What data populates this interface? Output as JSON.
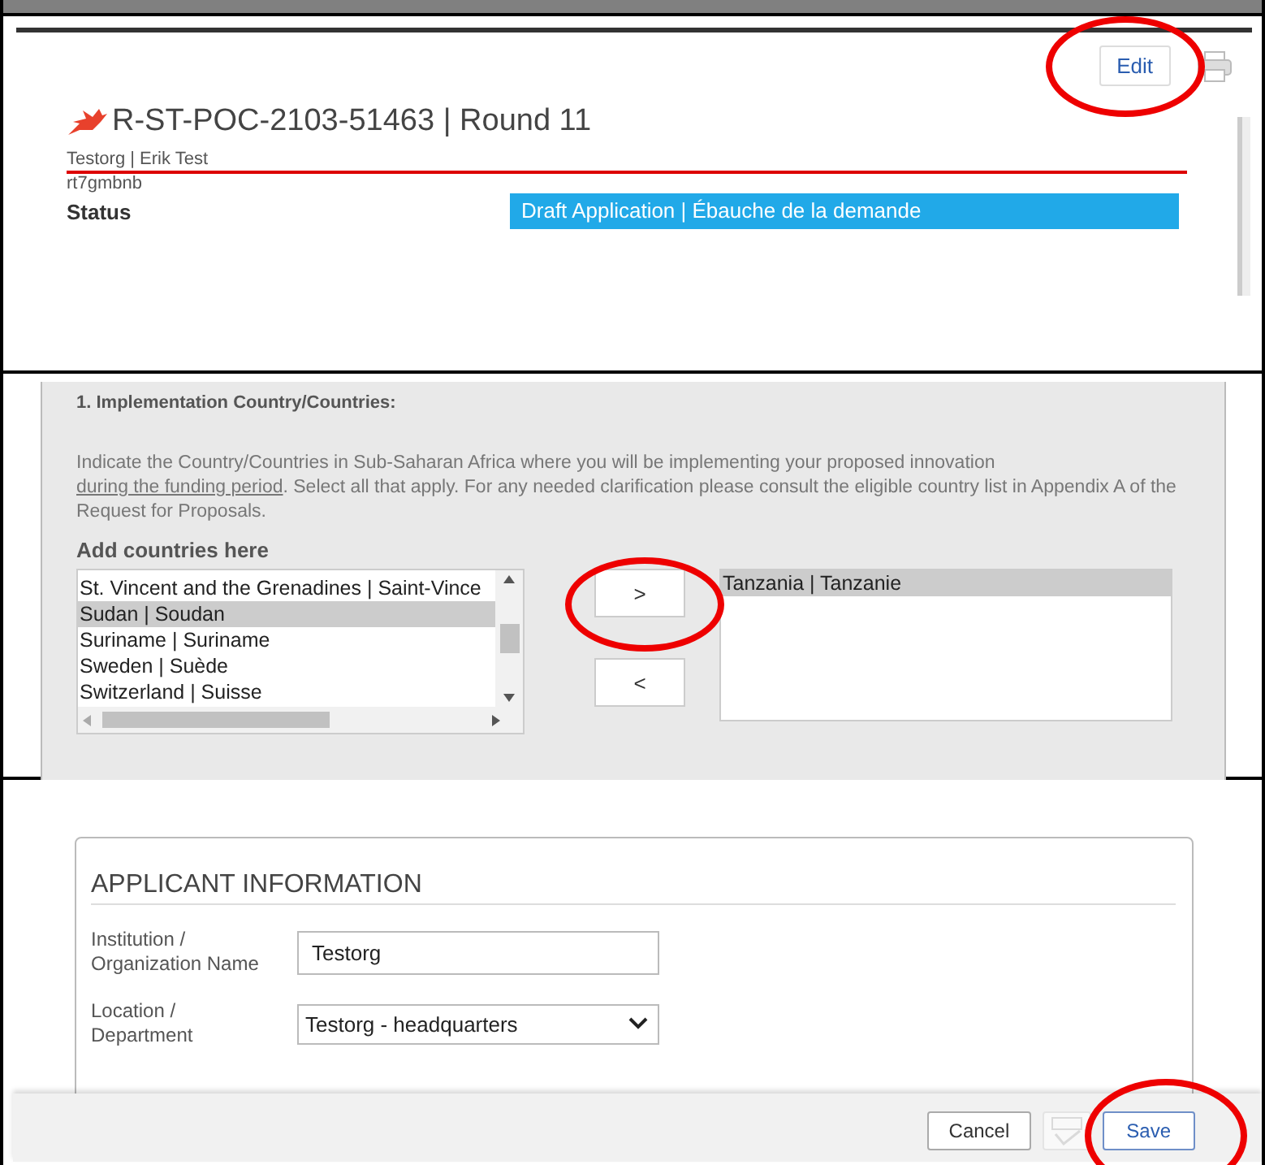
{
  "header": {
    "edit_button": "Edit",
    "title": "R-ST-POC-2103-51463 | Round 11",
    "subtitle": "Testorg | Erik Test",
    "code": "rt7gmbnb",
    "status_label": "Status",
    "status_value": "Draft Application | Ébauche de la demande"
  },
  "question": {
    "title": "1. Implementation Country/Countries:",
    "text_before": "Indicate the Country/Countries in Sub-Saharan Africa where you will be implementing your proposed innovation ",
    "link": "during the funding period",
    "text_after": ". Select all that apply. For any needed clarification please consult the eligible country list in Appendix A of the Request for Proposals.",
    "list_label": "Add countries here",
    "available": [
      {
        "label": "St. Vincent and the Grenadines | Saint-Vince",
        "selected": false
      },
      {
        "label": "Sudan | Soudan",
        "selected": true
      },
      {
        "label": "Suriname | Suriname",
        "selected": false
      },
      {
        "label": "Sweden | Suède",
        "selected": false
      },
      {
        "label": "Switzerland | Suisse",
        "selected": false
      }
    ],
    "add_button": ">",
    "remove_button": "<",
    "chosen": [
      {
        "label": "Tanzania | Tanzanie",
        "selected": true
      }
    ]
  },
  "applicant": {
    "heading": "APPLICANT INFORMATION",
    "fields": [
      {
        "label": "Institution / Organization Name",
        "kind": "text",
        "value": "Testorg"
      },
      {
        "label": "Location / Department",
        "kind": "select",
        "value": "Testorg - headquarters"
      }
    ]
  },
  "footer": {
    "buttons": [
      {
        "label": "Cancel",
        "kind": "text",
        "disabled": false
      },
      {
        "kind": "spellcheck",
        "disabled": true
      },
      {
        "label": "Save",
        "kind": "primary",
        "disabled": false
      }
    ]
  }
}
